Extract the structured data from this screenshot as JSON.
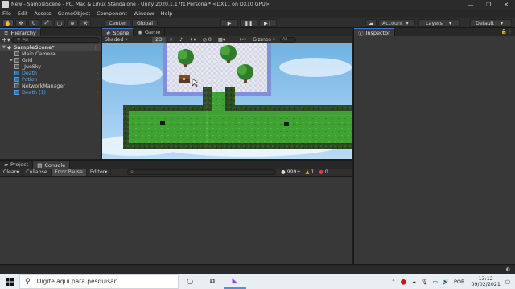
{
  "titlebar": {
    "title": "New - SampleScene - PC, Mac & Linux Standalone - Unity 2020.1.17f1 Personal* <DX11 on DX10 GPU>",
    "minimize": "—",
    "maximize": "❐",
    "close": "✕"
  },
  "menu": [
    "File",
    "Edit",
    "Assets",
    "GameObject",
    "Component",
    "Window",
    "Help"
  ],
  "toolbar": {
    "center": "Center",
    "global": "Global",
    "account": "Account",
    "layers": "Layers",
    "layout": "Default"
  },
  "hierarchy": {
    "tab": "Hierarchy",
    "search_placeholder": "All",
    "scene": "SampleScene*",
    "items": [
      {
        "label": "Main Camera"
      },
      {
        "label": "Grid"
      },
      {
        "label": "_JueSky"
      },
      {
        "label": "Death"
      },
      {
        "label": "Potion"
      },
      {
        "label": "NetworkManager"
      },
      {
        "label": "Death (1)"
      }
    ]
  },
  "scene": {
    "tab": "Scene",
    "game_tab": "Game",
    "shading": "Shaded",
    "mode_2d": "2D",
    "gizmos": "Gizmos",
    "search_placeholder": "All"
  },
  "inspector": {
    "tab": "Inspector"
  },
  "bottom": {
    "project_tab": "Project",
    "console_tab": "Console",
    "clear": "Clear",
    "collapse": "Collapse",
    "error_pause": "Error Pause",
    "editor": "Editor",
    "log_count": "999+",
    "warn_count": "1",
    "error_count": "0"
  },
  "taskbar": {
    "search_placeholder": "Digite aqui para pesquisar",
    "time": "13:12",
    "date": "09/02/2021",
    "lang": "POR"
  }
}
